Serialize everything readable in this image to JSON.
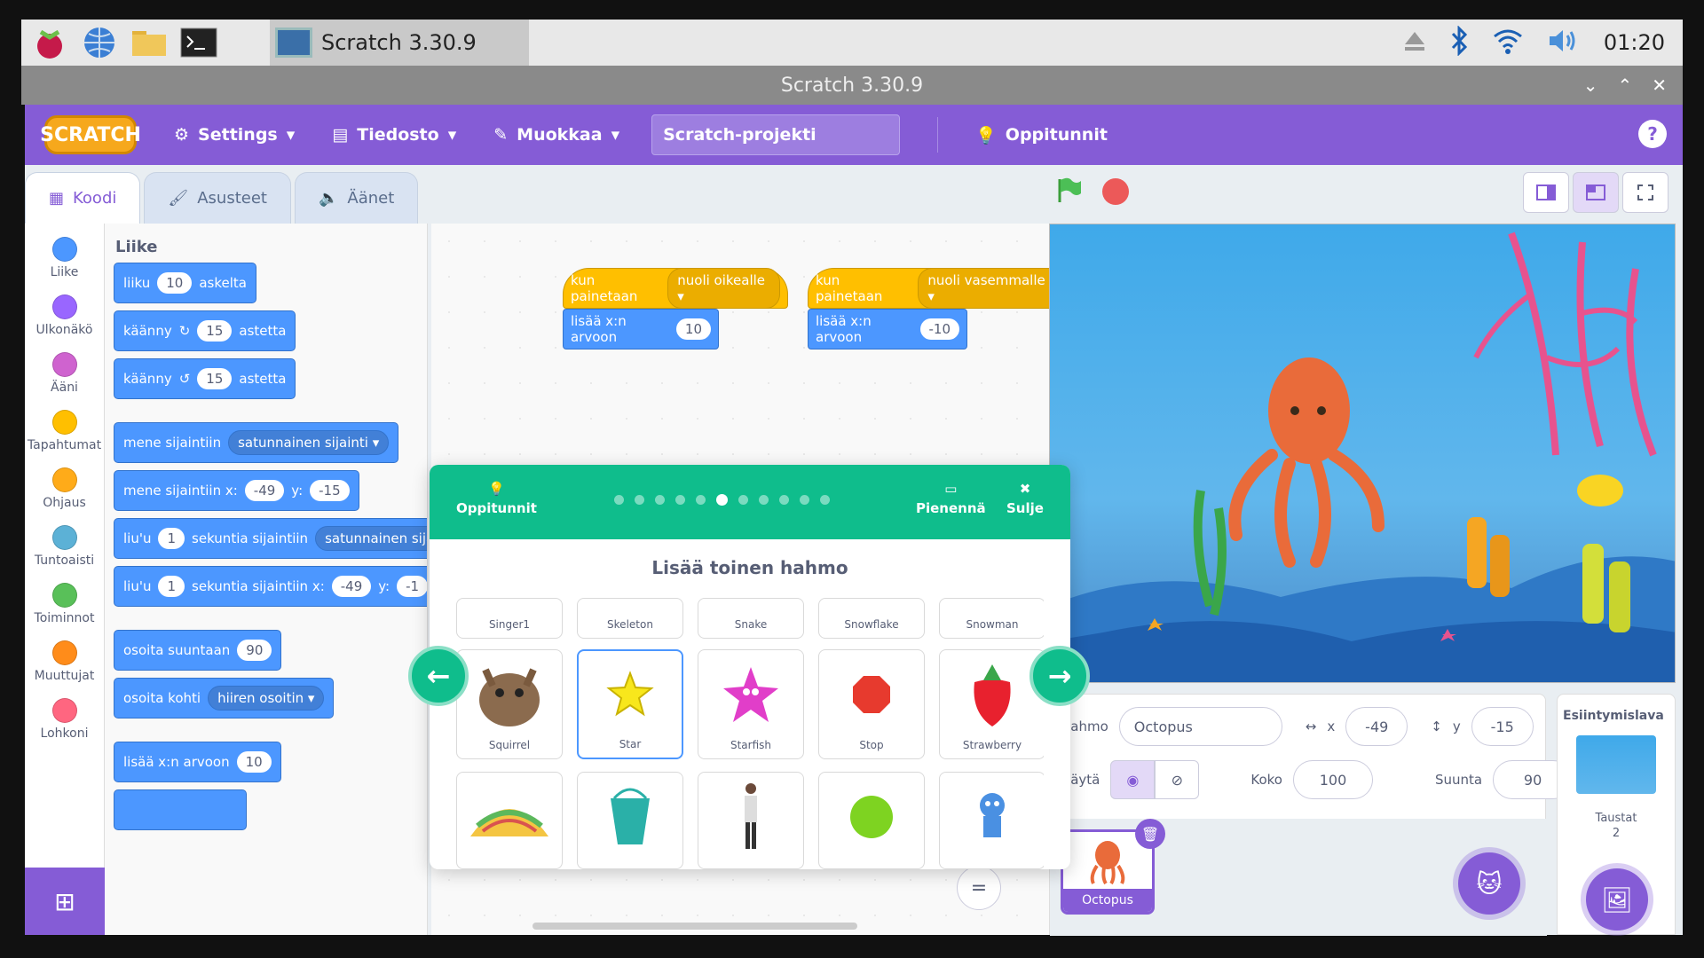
{
  "os": {
    "task_label": "Scratch 3.30.9",
    "clock": "01:20"
  },
  "window": {
    "title": "Scratch 3.30.9"
  },
  "menubar": {
    "logo": "SCRATCH",
    "settings": "Settings",
    "file": "Tiedosto",
    "edit": "Muokkaa",
    "project_title": "Scratch-projekti",
    "tutorials": "Oppitunnit",
    "help": "?"
  },
  "tabs": {
    "code": "Koodi",
    "costumes": "Asusteet",
    "sounds": "Äänet"
  },
  "categories": [
    {
      "label": "Liike",
      "color": "#4c97ff"
    },
    {
      "label": "Ulkonäkö",
      "color": "#9966ff"
    },
    {
      "label": "Ääni",
      "color": "#cf63cf"
    },
    {
      "label": "Tapahtumat",
      "color": "#ffbf00"
    },
    {
      "label": "Ohjaus",
      "color": "#ffab19"
    },
    {
      "label": "Tuntoaisti",
      "color": "#5cb1d6"
    },
    {
      "label": "Toiminnot",
      "color": "#59c059"
    },
    {
      "label": "Muuttujat",
      "color": "#ff8c1a"
    },
    {
      "label": "Lohkoni",
      "color": "#ff6680"
    }
  ],
  "palette": {
    "heading": "Liike",
    "b1": {
      "a": "liiku",
      "v": "10",
      "b": "askelta"
    },
    "b2": {
      "a": "käänny",
      "v": "15",
      "b": "astetta"
    },
    "b3": {
      "a": "käänny",
      "v": "15",
      "b": "astetta"
    },
    "b4": {
      "a": "mene sijaintiin",
      "dd": "satunnainen sijainti"
    },
    "b5": {
      "a": "mene sijaintiin x:",
      "x": "-49",
      "y_label": "y:",
      "y": "-15"
    },
    "b6": {
      "a": "liu'u",
      "v": "1",
      "b": "sekuntia sijaintiin",
      "dd": "satunnainen sijai"
    },
    "b7": {
      "a": "liu'u",
      "v": "1",
      "b": "sekuntia sijaintiin x:",
      "x": "-49",
      "y_label": "y:",
      "y": "-1"
    },
    "b8": {
      "a": "osoita suuntaan",
      "v": "90"
    },
    "b9": {
      "a": "osoita kohti",
      "dd": "hiiren osoitin"
    },
    "b10": {
      "a": "lisää x:n arvoon",
      "v": "10"
    }
  },
  "workspace": {
    "s1_hat": "kun painetaan",
    "s1_key": "nuoli oikealle",
    "s1_cmd": "lisää x:n arvoon",
    "s1_val": "10",
    "s2_hat": "kun painetaan",
    "s2_key": "nuoli vasemmalle",
    "s2_cmd": "lisää x:n arvoon",
    "s2_val": "-10",
    "zoom_reset": "="
  },
  "tutorial": {
    "label": "Oppitunnit",
    "shrink": "Pienennä",
    "close": "Sulje",
    "title": "Lisää toinen hahmo",
    "dots_total": 11,
    "dot_active": 6,
    "row1": [
      "Singer1",
      "Skeleton",
      "Snake",
      "Snowflake",
      "Snowman"
    ],
    "row2": [
      "Squirrel",
      "Star",
      "Starfish",
      "Stop",
      "Strawberry"
    ]
  },
  "sprite_info": {
    "sprite_label": "Hahmo",
    "name": "Octopus",
    "x_label": "x",
    "x": "-49",
    "y_label": "y",
    "y": "-15",
    "show_label": "Näytä",
    "size_label": "Koko",
    "size": "100",
    "direction_label": "Suunta",
    "direction": "90",
    "sprite_name": "Octopus"
  },
  "stage_panel": {
    "title": "Esiintymislava",
    "backdrops_label": "Taustat",
    "backdrops_count": "2"
  }
}
